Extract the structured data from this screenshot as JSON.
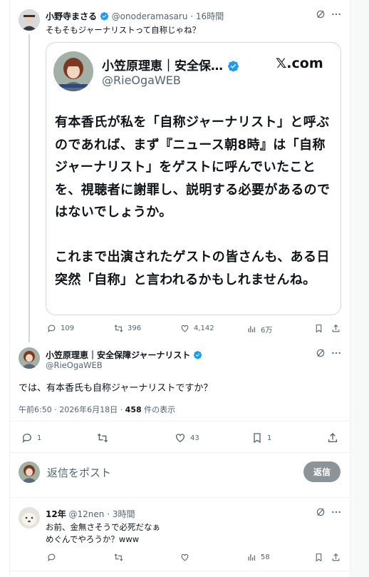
{
  "post1": {
    "author_name": "小野寺まさる",
    "handle": "@onoderamasaru",
    "time": "16時間",
    "text": "そもそもジャーナリストって自称じゃね？",
    "quote": {
      "name": "小笠原理恵｜安全保…",
      "handle": "@RieOgaWEB",
      "source": "𝕏.com",
      "paragraphs": [
        "有本香氏が私を「自称ジャーナリスト」と呼ぶのであれば、まず『ニュース朝8時』は「自称ジャーナリスト」をゲストに呼んでいたことを、視聴者に謝罪し、説明する必要があるのではないでしょうか。",
        "これまで出演されたゲストの皆さんも、ある日突然「自称」と言われるかもしれませんね。"
      ]
    },
    "stats": {
      "replies": "109",
      "reposts": "396",
      "likes": "4,142",
      "views": "6万"
    }
  },
  "post2": {
    "author_name": "小笠原理恵｜安全保障ジャーナリスト",
    "handle": "@RieOgaWEB",
    "text": "では、有本香氏も自称ジャーナリストですか？",
    "meta_time": "午前6:50 · 2026年6月18日 · ",
    "views_count": "458",
    "views_label": " 件の表示",
    "stats": {
      "replies": "1",
      "reposts": "",
      "likes": "43",
      "bookmarks": "1"
    }
  },
  "reply_box": {
    "placeholder": "返信をポスト",
    "button_label": "返信"
  },
  "post3": {
    "author_name": "12年",
    "handle": "@12nen",
    "time": "3時間",
    "text_line1": "お前、金無さそうで必死だなぁ",
    "text_line2": "めぐんでやろうか？www",
    "stats": {
      "views": "58"
    }
  },
  "colors": {
    "verified": "#1d9bf0",
    "text": "#0f1419",
    "muted": "#536471",
    "button": "#8c9499"
  },
  "icons": [
    "grok-icon",
    "more-icon",
    "reply-icon",
    "repost-icon",
    "like-icon",
    "views-icon",
    "bookmark-icon",
    "share-icon",
    "verified-badge-icon"
  ]
}
